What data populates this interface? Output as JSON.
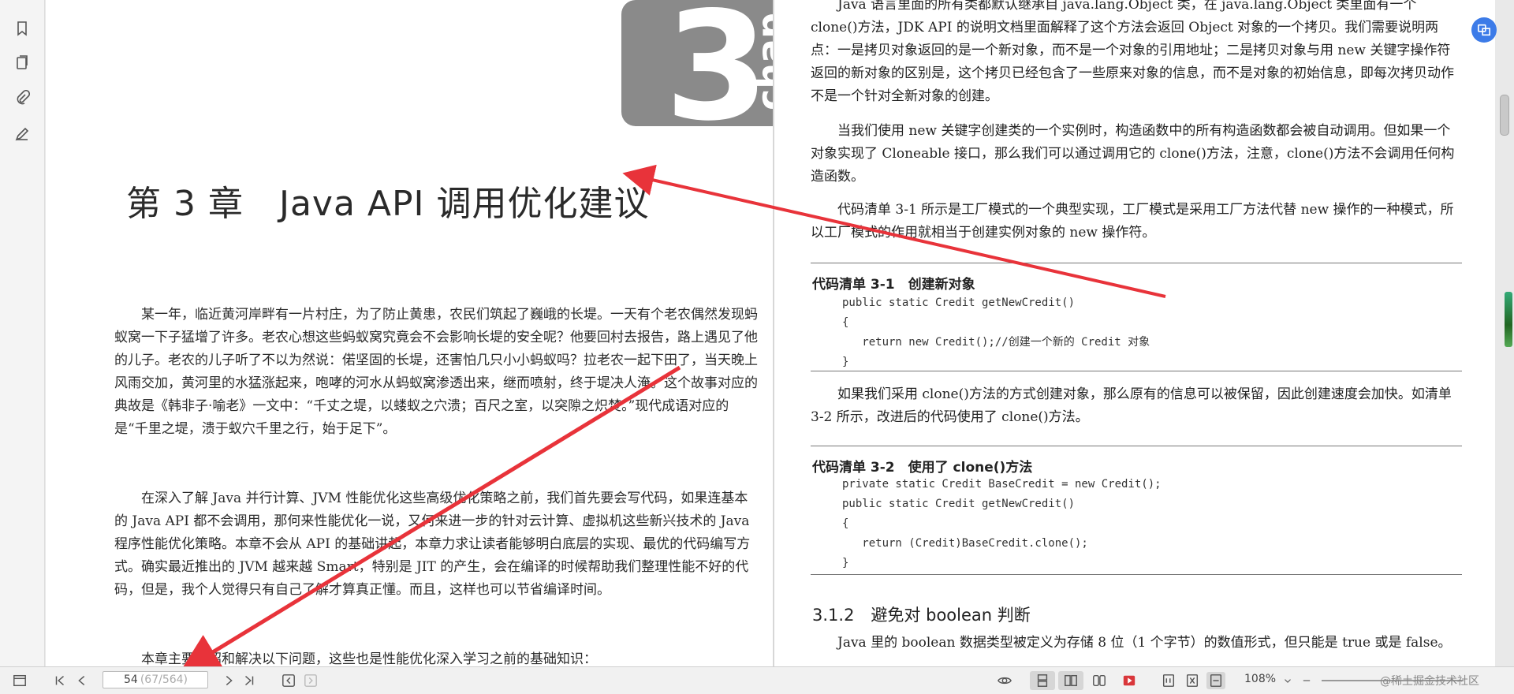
{
  "left_page": {
    "badge_number": "3",
    "badge_word": "chap",
    "chapter_title": "第 3 章　Java API 调用优化建议",
    "paragraphs": [
      "某一年，临近黄河岸畔有一片村庄，为了防止黄患，农民们筑起了巍峨的长堤。一天有个老农偶然发现蚂蚁窝一下子猛增了许多。老农心想这些蚂蚁窝究竟会不会影响长堤的安全呢？他要回村去报告，路上遇见了他的儿子。老农的儿子听了不以为然说：偌坚固的长堤，还害怕几只小小蚂蚁吗？拉老农一起下田了，当天晚上风雨交加，黄河里的水猛涨起来，咆哮的河水从蚂蚁窝渗透出来，继而喷射，终于堤决人淹。这个故事对应的典故是《韩非子·喻老》一文中：“千丈之堤，以蝼蚁之穴溃；百尺之室，以突隙之炽焚。”现代成语对应的是“千里之堤，溃于蚁穴千里之行，始于足下”。",
      "在深入了解 Java 并行计算、JVM 性能优化这些高级优化策略之前，我们首先要会写代码，如果连基本的 Java API 都不会调用，那何来性能优化一说，又何来进一步的针对云计算、虚拟机这些新兴技术的 Java 程序性能优化策略。本章不会从 API 的基础讲起，本章力求让读者能够明白底层的实现、最优的代码编写方式。确实最近推出的 JVM 越来越 Smart，特别是 JIT 的产生，会在编译的时候帮助我们整理性能不好的代码，但是，我个人觉得只有自己了解才算真正懂。而且，这样也可以节省编译时间。",
      "本章主要介绍和解决以下问题，这些也是性能优化深入学习之前的基础知识："
    ]
  },
  "right_page": {
    "p1": "Java 语言里面的所有类都默认继承自 java.lang.Object 类，在 java.lang.Object 类里面有一个 clone()方法，JDK API 的说明文档里面解释了这个方法会返回 Object 对象的一个拷贝。我们需要说明两点：一是拷贝对象返回的是一个新对象，而不是一个对象的引用地址；二是拷贝对象与用 new 关键字操作符返回的新对象的区别是，这个拷贝已经包含了一些原来对象的信息，而不是对象的初始信息，即每次拷贝动作不是一个针对全新对象的创建。",
    "p2": "当我们使用 new 关键字创建类的一个实例时，构造函数中的所有构造函数都会被自动调用。但如果一个对象实现了 Cloneable 接口，那么我们可以通过调用它的 clone()方法，注意，clone()方法不会调用任何构造函数。",
    "p3": "代码清单 3-1 所示是工厂模式的一个典型实现，工厂模式是采用工厂方法代替 new 操作的一种模式，所以工厂模式的作用就相当于创建实例对象的 new 操作符。",
    "listing1_title": "代码清单 3-1　创建新对象",
    "listing1_code": [
      "public static Credit getNewCredit()",
      "{",
      "   return new Credit();//创建一个新的 Credit 对象",
      "}"
    ],
    "p4": "如果我们采用 clone()方法的方式创建对象，那么原有的信息可以被保留，因此创建速度会加快。如清单 3-2 所示，改进后的代码使用了 clone()方法。",
    "listing2_title": "代码清单 3-2　使用了 clone()方法",
    "listing2_code": [
      "private static Credit BaseCredit = new Credit();",
      "public static Credit getNewCredit()",
      "{",
      "   return (Credit)BaseCredit.clone();",
      "}"
    ],
    "section_heading": "3.1.2　避免对 boolean 判断",
    "p5": "Java 里的 boolean 数据类型被定义为存储 8 位（1 个字节）的数值形式，但只能是 true 或是 false。"
  },
  "statusbar": {
    "current_page": "54",
    "page_of": "(67/564)",
    "zoom": "108%",
    "watermark": "@稀土掘金技术社区"
  },
  "icons": {
    "rail": [
      "bookmark-icon",
      "pages-icon",
      "attachment-icon",
      "sign-icon"
    ],
    "fab": "translate-icon"
  },
  "colors": {
    "badge_gray": "#8a8a8a",
    "arrow_red": "#e8333a",
    "fab_blue": "#3c7be8",
    "play_red": "#d9373b"
  }
}
